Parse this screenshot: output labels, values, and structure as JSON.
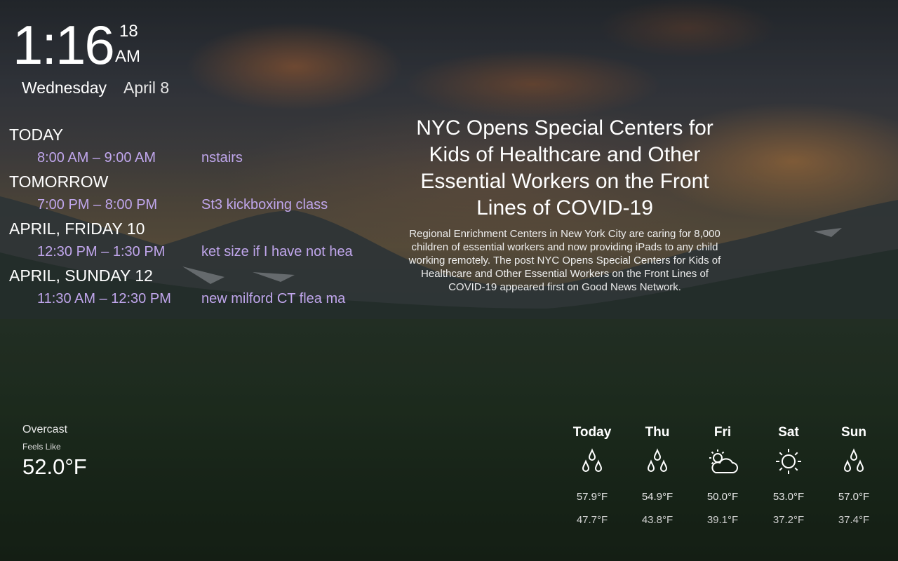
{
  "clock": {
    "time": "1:16",
    "seconds": "18",
    "ampm": "AM",
    "weekday": "Wednesday",
    "date": "April 8"
  },
  "agenda": [
    {
      "day": "Today",
      "events": [
        {
          "time": "8:00 AM – 9:00 AM",
          "title": "nstairs"
        }
      ]
    },
    {
      "day": "Tomorrow",
      "events": [
        {
          "time": "7:00 PM – 8:00 PM",
          "title": "St3 kickboxing class"
        }
      ]
    },
    {
      "day": "April, Friday 10",
      "events": [
        {
          "time": "12:30 PM – 1:30 PM",
          "title": "ket size if I have not hea"
        }
      ]
    },
    {
      "day": "April, Sunday 12",
      "events": [
        {
          "time": "11:30 AM – 12:30 PM",
          "title": "new milford CT flea ma"
        }
      ]
    }
  ],
  "news": {
    "headline": "NYC Opens Special Centers for Kids of Healthcare and Other Essential Workers on the Front Lines of COVID-19",
    "summary": "Regional Enrichment Centers in New York City are caring for 8,000 children of essential workers and now providing iPads to any child working remotely. The post NYC Opens Special Centers for Kids of Healthcare and Other Essential Workers on the Front Lines of COVID-19 appeared first on Good News Network."
  },
  "weather": {
    "current": {
      "summary": "Overcast",
      "feels_like_label": "Feels Like",
      "feels_like": "52.0°F"
    },
    "forecast": [
      {
        "day": "Today",
        "icon": "rain-drops-icon",
        "high": "57.9°F",
        "low": "47.7°F"
      },
      {
        "day": "Thu",
        "icon": "rain-drops-icon",
        "high": "54.9°F",
        "low": "43.8°F"
      },
      {
        "day": "Fri",
        "icon": "partly-cloudy-icon",
        "high": "50.0°F",
        "low": "39.1°F"
      },
      {
        "day": "Sat",
        "icon": "sun-icon",
        "high": "53.0°F",
        "low": "37.2°F"
      },
      {
        "day": "Sun",
        "icon": "rain-drops-icon",
        "high": "57.0°F",
        "low": "37.4°F"
      }
    ]
  },
  "colors": {
    "event_text": "#c0a6ec",
    "primary_text": "#ffffff"
  }
}
